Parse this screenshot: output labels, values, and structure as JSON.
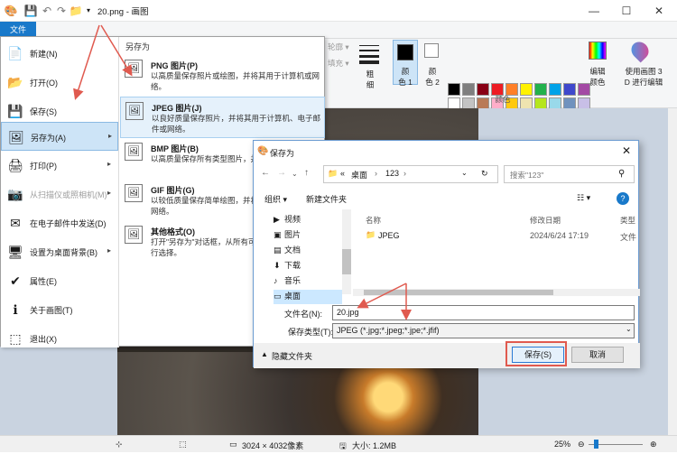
{
  "titlebar": {
    "title": "20.png - 画图",
    "minimize": "—",
    "maximize": "☐",
    "close": "✕"
  },
  "ribbon": {
    "file_tab": "文件",
    "outline": "轮廓 ▾",
    "fill": "填充 ▾",
    "thickness": "粗\n细",
    "color1": "颜\n色 1",
    "color2": "颜\n色 2",
    "edit_colors": "编辑\n颜色",
    "paint3d": "使用画图 3\nD 进行编辑",
    "colors_group": "颜色",
    "palette_row1": [
      "#000000",
      "#7f7f7f",
      "#880015",
      "#ed1c24",
      "#ff7f27",
      "#fff200",
      "#22b14c",
      "#00a2e8",
      "#3f48cc",
      "#a349a4"
    ],
    "palette_row2": [
      "#ffffff",
      "#c3c3c3",
      "#b97a57",
      "#ffaec9",
      "#ffc90e",
      "#efe4b0",
      "#b5e61d",
      "#99d9ea",
      "#7092be",
      "#c8bfe7"
    ],
    "palette_row3": [
      "#ffffff",
      "#ffffff",
      "#ffffff",
      "#ffffff",
      "#ffffff",
      "#ffffff",
      "#ffffff",
      "#ffffff",
      "#ffffff",
      "#ffffff"
    ]
  },
  "file_menu": {
    "items": [
      {
        "label": "新建(N)",
        "icon": "📄"
      },
      {
        "label": "打开(O)",
        "icon": "📂"
      },
      {
        "label": "保存(S)",
        "icon": "💾"
      },
      {
        "label": "另存为(A)",
        "icon": "🖼"
      },
      {
        "label": "打印(P)",
        "icon": "🖨"
      },
      {
        "label": "从扫描仪或照相机(M)",
        "icon": "📷"
      },
      {
        "label": "在电子邮件中发送(D)",
        "icon": "✉"
      },
      {
        "label": "设置为桌面背景(B)",
        "icon": "🖥"
      },
      {
        "label": "属性(E)",
        "icon": "✔"
      },
      {
        "label": "关于画图(T)",
        "icon": "ℹ"
      },
      {
        "label": "退出(X)",
        "icon": "⬚"
      }
    ],
    "submenu_title": "另存为",
    "formats": [
      {
        "title": "PNG 图片(P)",
        "desc": "以高质量保存照片或绘图，并将其用于计算机或网络。"
      },
      {
        "title": "JPEG 图片(J)",
        "desc": "以良好质量保存照片，并将其用于计算机、电子邮件或网络。"
      },
      {
        "title": "BMP 图片(B)",
        "desc": "以高质量保存所有类型图片，并将"
      },
      {
        "title": "GIF 图片(G)",
        "desc": "以较低质量保存简单绘图，并将其用于电子邮件或网络。"
      },
      {
        "title": "其他格式(O)",
        "desc": "打开\"另存为\"对话框，从所有可能的文件类型中进行选择。"
      }
    ]
  },
  "dialog": {
    "title": "保存为",
    "path": [
      "«",
      "桌面",
      "›",
      "123",
      "›"
    ],
    "search_placeholder": "搜索\"123\"",
    "organize": "组织 ▾",
    "new_folder": "新建文件夹",
    "nav_items": [
      "视频",
      "图片",
      "文档",
      "下载",
      "音乐",
      "桌面"
    ],
    "columns": [
      "名称",
      "修改日期",
      "类型"
    ],
    "files": [
      {
        "name": "JPEG",
        "date": "2024/6/24 17:19",
        "type": "文件"
      }
    ],
    "filename_label": "文件名(N):",
    "filename_value": "20.jpg",
    "filetype_label": "保存类型(T):",
    "filetype_value": "JPEG (*.jpg;*.jpeg;*.jpe;*.jfif)",
    "hide_folders": "隐藏文件夹",
    "save": "保存(S)",
    "cancel": "取消"
  },
  "statusbar": {
    "dimensions": "3024 × 4032像素",
    "size": "大小: 1.2MB",
    "zoom": "25%"
  }
}
